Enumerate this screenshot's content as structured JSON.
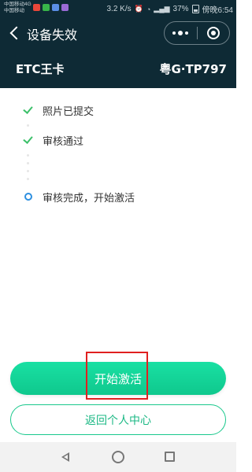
{
  "status_bar": {
    "carrier_line1": "中国移动4G",
    "carrier_line2": "中国移动",
    "speed": "3.2 K/s",
    "battery": "37%",
    "time": "傍晚6:54"
  },
  "title_bar": {
    "title": "设备失效"
  },
  "card": {
    "name": "ETC王卡",
    "plate": "粤G·TP797"
  },
  "timeline": {
    "steps": [
      {
        "label": "照片已提交",
        "status": "done"
      },
      {
        "label": "审核通过",
        "status": "done"
      },
      {
        "label": "审核完成，开始激活",
        "status": "current"
      }
    ]
  },
  "buttons": {
    "activate": "开始激活",
    "back_to_profile": "返回个人中心"
  },
  "colors": {
    "header_bg": "#0e2a35",
    "accent_green": "#19e0a3",
    "check_green": "#3cc06a",
    "current_blue": "#2d8fe0",
    "highlight_red": "#e02020"
  }
}
